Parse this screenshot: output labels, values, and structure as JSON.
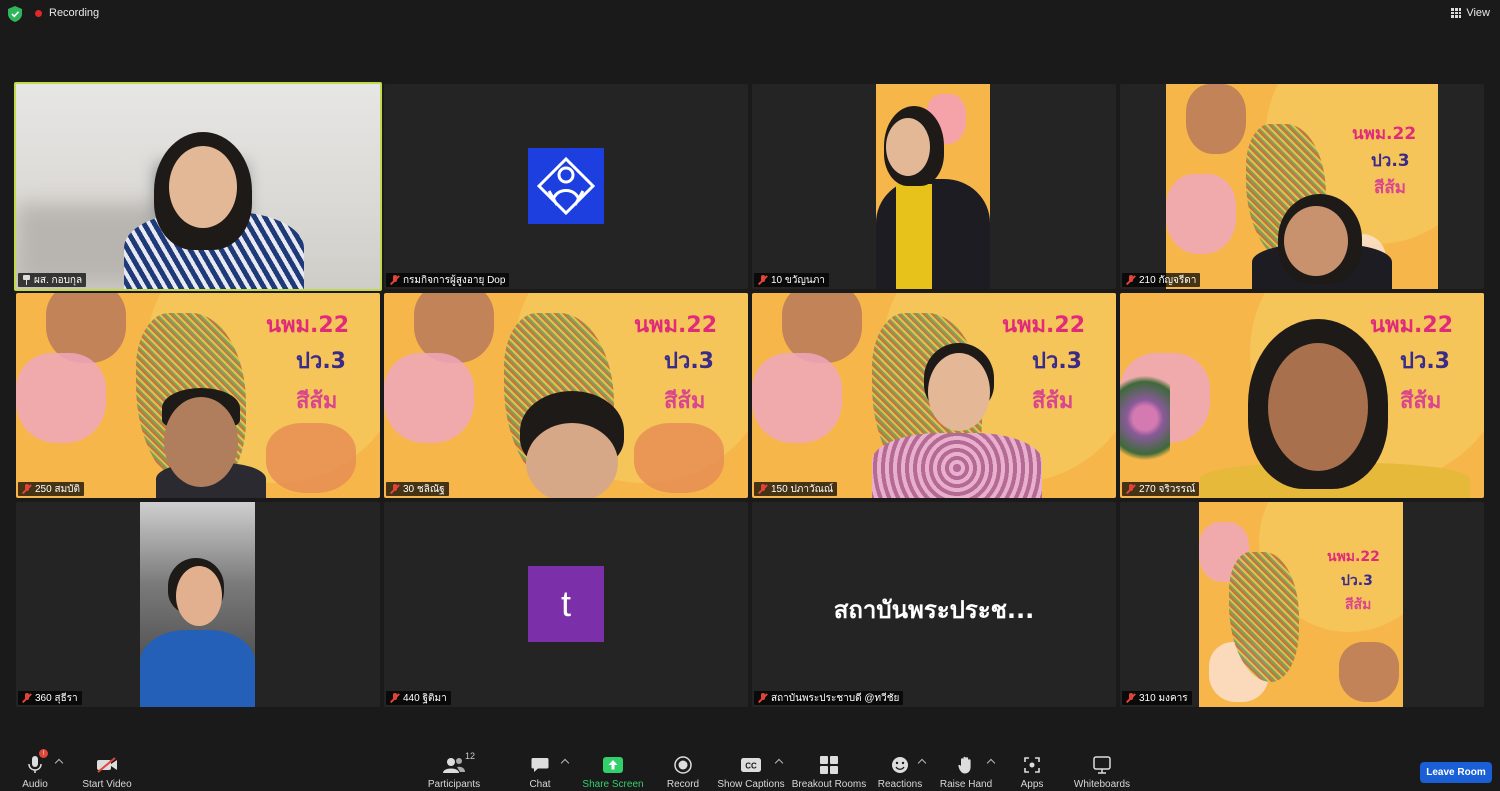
{
  "topbar": {
    "recording_label": "Recording",
    "view_label": "View",
    "recording_color": "#e02828"
  },
  "participants": [
    {
      "name": "ผส. กอบกุล",
      "status": "pinned"
    },
    {
      "name": "กรมกิจการผู้สูงอายุ Dop",
      "status": "muted"
    },
    {
      "name": "10 ขวัญนภา",
      "status": "muted"
    },
    {
      "name": "210 กัญจรีดา",
      "status": "muted"
    },
    {
      "name": "250 สมบัติ",
      "status": "muted"
    },
    {
      "name": "30 ชลิณัฐ",
      "status": "muted"
    },
    {
      "name": "150 ปภาวัณณ์",
      "status": "muted"
    },
    {
      "name": "270 จริวรรณ์",
      "status": "muted"
    },
    {
      "name": "360 สุธีรา",
      "status": "muted"
    },
    {
      "name": "440 ฐิติมา",
      "status": "muted"
    },
    {
      "name": "สถาบันพระประชาบดี @ทวีชัย",
      "status": "muted"
    },
    {
      "name": "310 มงคาร",
      "status": "muted"
    }
  ],
  "poster": {
    "line1": "นพม.22",
    "line2": "ปว.3",
    "line3": "สีส้ม"
  },
  "avatars": {
    "t_letter": "t",
    "institute_display": "สถาบันพระประช..."
  },
  "toolbar": {
    "audio": "Audio",
    "start_video": "Start Video",
    "participants": "Participants",
    "participants_count": "12",
    "chat": "Chat",
    "share_screen": "Share Screen",
    "record": "Record",
    "show_captions": "Show Captions",
    "breakout_rooms": "Breakout Rooms",
    "reactions": "Reactions",
    "raise_hand": "Raise Hand",
    "apps": "Apps",
    "whiteboards": "Whiteboards",
    "leave_room": "Leave Room",
    "share_color": "#32d06a",
    "leave_color": "#1a5fd6"
  }
}
